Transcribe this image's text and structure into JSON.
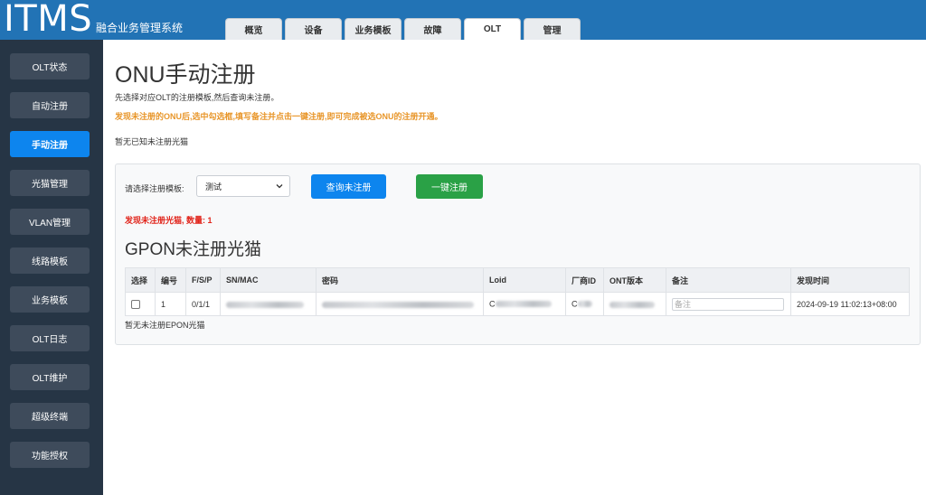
{
  "header": {
    "logo": "ITMS",
    "subtitle": "融合业务管理系统",
    "tabs": [
      "概览",
      "设备",
      "业务模板",
      "故障",
      "OLT",
      "管理"
    ],
    "active_tab": "OLT"
  },
  "sidebar": {
    "items": [
      "OLT状态",
      "自动注册",
      "手动注册",
      "光猫管理",
      "VLAN管理",
      "线路模板",
      "业务模板",
      "OLT日志",
      "OLT维护",
      "超级终端",
      "功能授权"
    ],
    "active": "手动注册"
  },
  "main": {
    "title": "ONU手动注册",
    "intro": "先选择对应OLT的注册模板,然后查询未注册。",
    "warning": "发现未注册的ONU后,选中勾选框,填写备注并点击一键注册,即可完成被选ONU的注册开通。",
    "none_known": "暂无已知未注册光猫",
    "panel": {
      "select_label": "请选择注册模板:",
      "select_value": "测试",
      "query_button": "查询未注册",
      "register_button": "一键注册",
      "found_text": "发现未注册光猫, 数量: 1",
      "gpon_title": "GPON未注册光猫",
      "table": {
        "headers": [
          "选择",
          "编号",
          "F/S/P",
          "SN/MAC",
          "密码",
          "Loid",
          "厂商ID",
          "ONT版本",
          "备注",
          "发现时间"
        ],
        "rows": [
          {
            "index": "1",
            "fsp": "0/1/1",
            "password_prefix": "",
            "loid_prefix": "C",
            "vendor_prefix": "C",
            "note_placeholder": "备注",
            "discovered": "2024-09-19 11:02:13+08:00"
          }
        ]
      },
      "epon_none": "暂无未注册EPON光猫"
    }
  },
  "colors": {
    "header_bg": "#2273b5",
    "sidebar_bg": "#263545",
    "primary": "#0d85ee",
    "success": "#2aa146",
    "warning": "#e8962a",
    "danger": "#e1261c"
  }
}
